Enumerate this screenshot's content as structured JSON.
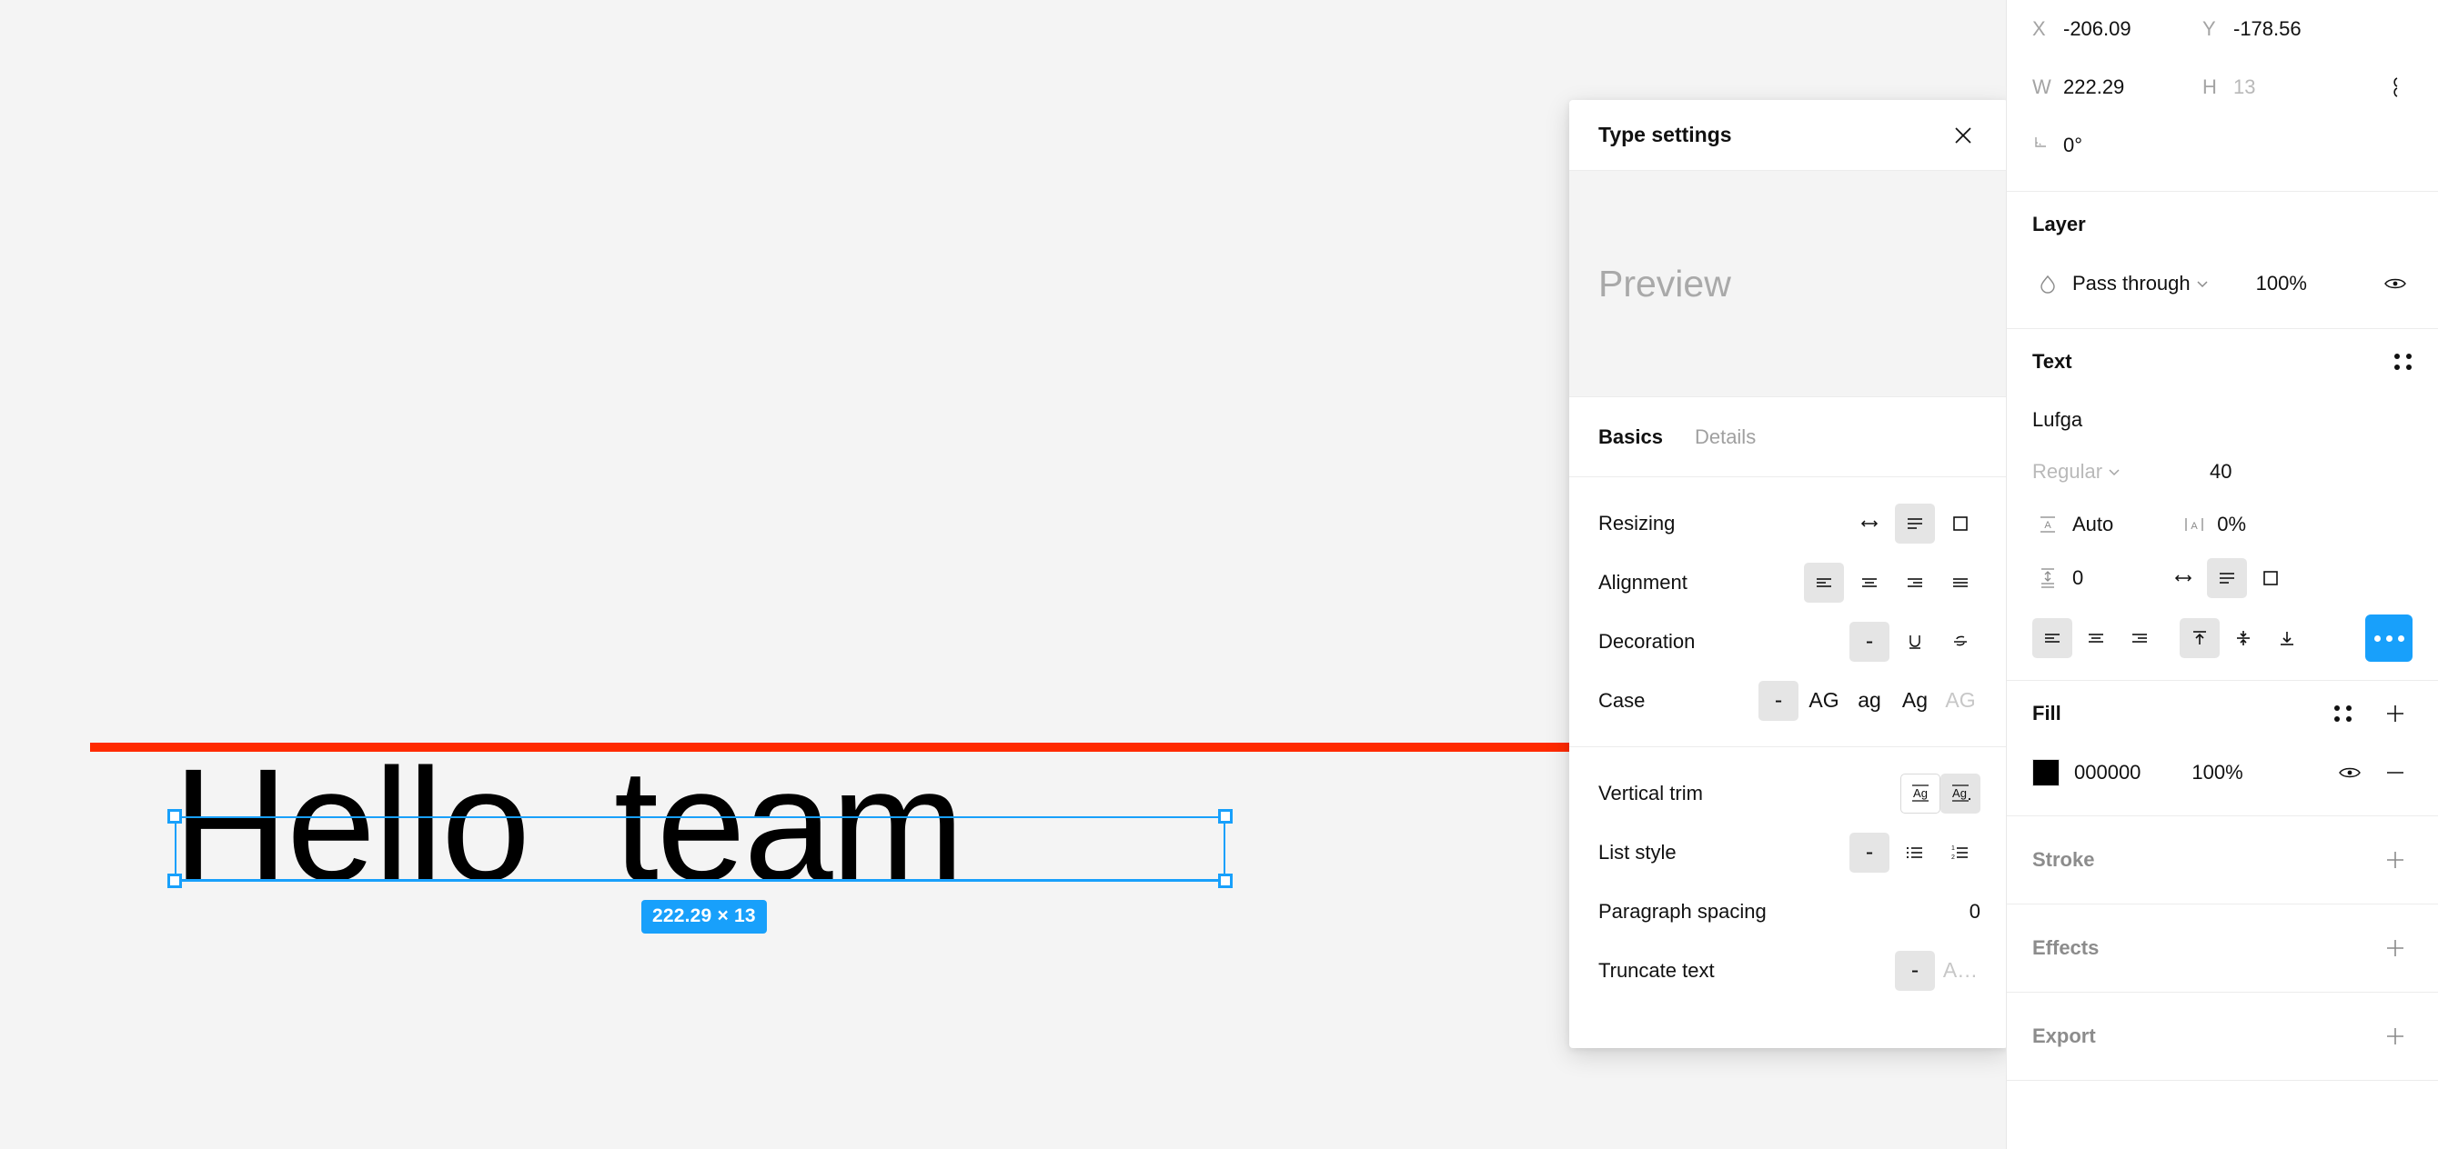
{
  "canvas": {
    "text_layer": "Hello  team",
    "dimension_badge": "222.29 × 13",
    "guide_color": "#ff2a00",
    "selection_color": "#18a0fb"
  },
  "type_panel": {
    "title": "Type settings",
    "close_icon": "close-icon",
    "preview_placeholder": "Preview",
    "tabs": [
      {
        "label": "Basics",
        "active": true
      },
      {
        "label": "Details",
        "active": false
      }
    ],
    "rows": [
      {
        "label": "Resizing",
        "options": [
          {
            "icon": "auto-width-icon",
            "glyph": "↔",
            "active": false
          },
          {
            "icon": "auto-height-icon",
            "glyph": "align-lines",
            "active": true
          },
          {
            "icon": "fixed-size-icon",
            "glyph": "square",
            "active": false
          }
        ]
      },
      {
        "label": "Alignment",
        "options": [
          {
            "icon": "align-left-icon",
            "glyph": "align-left",
            "active": true
          },
          {
            "icon": "align-center-icon",
            "glyph": "align-center",
            "active": false
          },
          {
            "icon": "align-right-icon",
            "glyph": "align-right",
            "active": false
          },
          {
            "icon": "align-justify-icon",
            "glyph": "align-justify",
            "active": false
          }
        ]
      },
      {
        "label": "Decoration",
        "options": [
          {
            "icon": "no-decoration-icon",
            "glyph": "-",
            "active": true
          },
          {
            "icon": "underline-icon",
            "glyph": "U",
            "active": false
          },
          {
            "icon": "strikethrough-icon",
            "glyph": "S",
            "active": false
          }
        ]
      },
      {
        "label": "Case",
        "options": [
          {
            "icon": "case-none-icon",
            "glyph": "-",
            "active": true
          },
          {
            "icon": "uppercase-icon",
            "glyph": "AG",
            "active": false
          },
          {
            "icon": "lowercase-icon",
            "glyph": "ag",
            "active": false
          },
          {
            "icon": "titlecase-icon",
            "glyph": "Ag",
            "active": false
          },
          {
            "icon": "smallcaps-icon",
            "glyph": "AG",
            "active": false,
            "disabled": true
          }
        ]
      },
      {
        "label": "Vertical trim",
        "options": [
          {
            "icon": "vertical-trim-standard-icon",
            "glyph": "Ag",
            "active": false,
            "outlined": true
          },
          {
            "icon": "vertical-trim-capheight-icon",
            "glyph": "Ag.",
            "active": true
          }
        ]
      },
      {
        "label": "List style",
        "options": [
          {
            "icon": "list-none-icon",
            "glyph": "-",
            "active": true
          },
          {
            "icon": "bulleted-list-icon",
            "glyph": "bullets",
            "active": false
          },
          {
            "icon": "numbered-list-icon",
            "glyph": "numbers",
            "active": false
          }
        ]
      },
      {
        "label": "Paragraph spacing",
        "value": "0"
      },
      {
        "label": "Truncate text",
        "options": [
          {
            "icon": "truncate-off-icon",
            "glyph": "-",
            "active": true
          },
          {
            "icon": "truncate-on-icon",
            "glyph": "A…",
            "active": false,
            "disabled": true
          }
        ]
      }
    ]
  },
  "sidebar": {
    "transform": {
      "x_key": "X",
      "x_value": "-206.09",
      "y_key": "Y",
      "y_value": "-178.56",
      "w_key": "W",
      "w_value": "222.29",
      "h_key": "H",
      "h_value": "13",
      "rotation_value": "0°",
      "constrain_icon": "constrain-proportions-icon",
      "rotation_icon": "rotation-angle-icon"
    },
    "layer": {
      "title": "Layer",
      "blend_icon": "blend-mode-icon",
      "blend_mode": "Pass through",
      "chevron_icon": "chevron-down-icon",
      "opacity": "100%",
      "visibility_icon": "eye-icon"
    },
    "text": {
      "title": "Text",
      "grip_icon": "grip-icon",
      "font_family": "Lufga",
      "font_weight": "Regular",
      "weight_chevron_icon": "chevron-down-icon",
      "font_size": "40",
      "line_height_icon": "line-height-icon",
      "line_height": "Auto",
      "letter_spacing_icon": "letter-spacing-icon",
      "letter_spacing": "0%",
      "paragraph_spacing_icon": "paragraph-spacing-icon",
      "paragraph_spacing": "0",
      "resizing": [
        {
          "icon": "auto-width-icon",
          "active": false
        },
        {
          "icon": "auto-height-icon",
          "active": true
        },
        {
          "icon": "fixed-size-icon",
          "active": false
        }
      ],
      "horizontal_align": [
        {
          "icon": "align-left-icon",
          "active": true
        },
        {
          "icon": "align-center-icon",
          "active": false
        },
        {
          "icon": "align-right-icon",
          "active": false
        }
      ],
      "vertical_align": [
        {
          "icon": "align-top-icon",
          "active": true
        },
        {
          "icon": "align-middle-icon",
          "active": false
        },
        {
          "icon": "align-bottom-icon",
          "active": false
        }
      ],
      "more_button_icon": "more-options-icon",
      "more_button_color": "#18a0fb"
    },
    "fill": {
      "title": "Fill",
      "grip_icon": "grip-icon",
      "add_icon": "plus-icon",
      "color_hex": "000000",
      "color_value": "#000000",
      "opacity": "100%",
      "visibility_icon": "eye-icon",
      "remove_icon": "minus-icon"
    },
    "stroke": {
      "title": "Stroke",
      "add_icon": "plus-icon"
    },
    "effects": {
      "title": "Effects",
      "add_icon": "plus-icon"
    },
    "export": {
      "title": "Export",
      "add_icon": "plus-icon"
    }
  }
}
